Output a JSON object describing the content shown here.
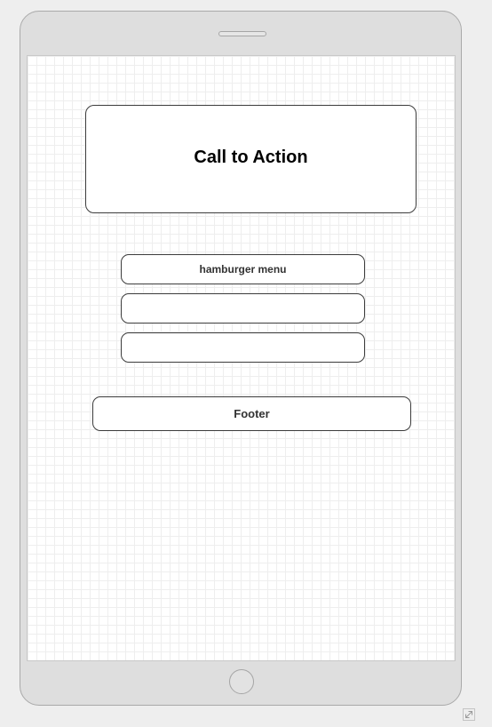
{
  "mockup": {
    "call_to_action_label": "Call to Action",
    "menu_items": [
      "hamburger menu",
      "",
      ""
    ],
    "footer_label": "Footer"
  },
  "colors": {
    "device_body": "#dedede",
    "device_border": "#a9a9a9",
    "screen_background": "#ffffff",
    "grid_line": "#eeeeee",
    "box_border": "#3c3c3c",
    "text_primary": "#000000",
    "text_secondary": "#333333"
  },
  "icons": {
    "resize_handle": "resize-icon",
    "home_button": "home-button-icon",
    "speaker": "speaker-icon"
  }
}
